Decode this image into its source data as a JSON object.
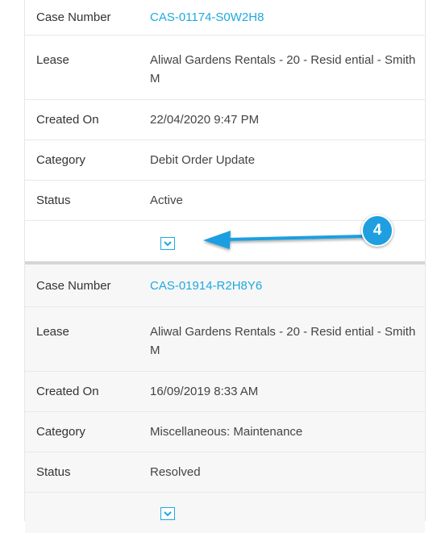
{
  "cases": [
    {
      "fields": [
        {
          "label": "Case Number",
          "value": "CAS-01174-S0W2H8"
        },
        {
          "label": "Lease",
          "value": "Aliwal Gardens Rentals - 20 - Resid ential - Smith M"
        },
        {
          "label": "Created On",
          "value": "22/04/2020 9:47 PM"
        },
        {
          "label": "Category",
          "value": "Debit Order Update"
        },
        {
          "label": "Status",
          "value": "Active"
        }
      ],
      "expand_icon": "chevron-down-icon"
    },
    {
      "fields": [
        {
          "label": "Case Number",
          "value": "CAS-01914-R2H8Y6"
        },
        {
          "label": "Lease",
          "value": "Aliwal Gardens Rentals - 20 - Resid ential - Smith M"
        },
        {
          "label": "Created On",
          "value": "16/09/2019 8:33 AM"
        },
        {
          "label": "Category",
          "value": "Miscellaneous: Maintenance"
        },
        {
          "label": "Status",
          "value": "Resolved"
        }
      ],
      "expand_icon": "chevron-down-icon"
    }
  ],
  "annotation": {
    "step_number": "4",
    "color": "#1f9fe0"
  },
  "colors": {
    "link": "#1ea9e1",
    "divider": "#e9e9e9"
  }
}
